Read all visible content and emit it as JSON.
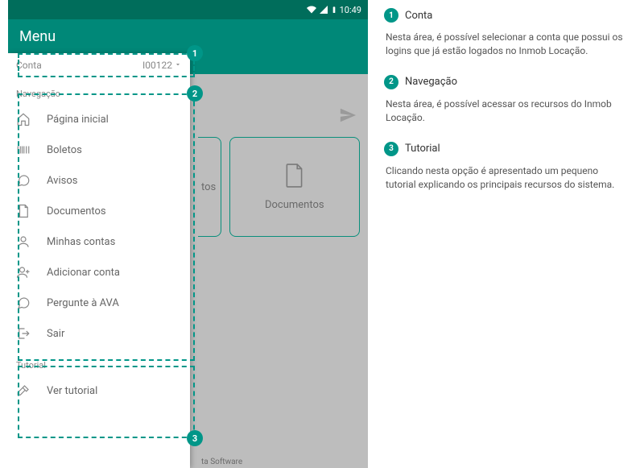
{
  "statusbar": {
    "time": "10:49"
  },
  "appbar": {
    "title": "Menu"
  },
  "account": {
    "label": "Conta",
    "value": "I00122"
  },
  "nav_header": "Navegação",
  "nav_items": [
    {
      "label": "Página inicial"
    },
    {
      "label": "Boletos"
    },
    {
      "label": "Avisos"
    },
    {
      "label": "Documentos"
    },
    {
      "label": "Minhas contas"
    },
    {
      "label": "Adicionar conta"
    },
    {
      "label": "Pergunte à AVA"
    },
    {
      "label": "Sair"
    }
  ],
  "tutorial_header": "Tutorial",
  "tutorial_item": {
    "label": "Ver tutorial"
  },
  "underlay": {
    "card_partial_label": "tos",
    "card_label": "Documentos",
    "footer": "ta Software"
  },
  "markers": {
    "m1": "1",
    "m2": "2",
    "m3": "3"
  },
  "doc": {
    "s1": {
      "num": "1",
      "title": "Conta",
      "body": "Nesta área, é possível selecionar a conta que possui os logins que já estão logados no Inmob Locação."
    },
    "s2": {
      "num": "2",
      "title": "Navegação",
      "body": "Nesta área, é possível acessar os recursos do Inmob Locação."
    },
    "s3": {
      "num": "3",
      "title": "Tutorial",
      "body": "Clicando nesta opção é apresentado um pequeno tutorial explicando os principais recursos do sistema."
    }
  }
}
